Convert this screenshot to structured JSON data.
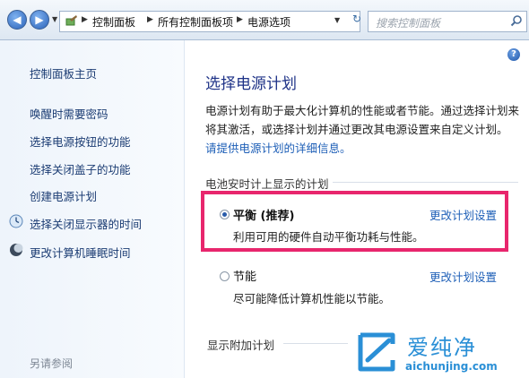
{
  "address_bar": {
    "breadcrumbs": [
      "控制面板",
      "所有控制面板项",
      "电源选项"
    ],
    "search_placeholder": "搜索控制面板"
  },
  "sidebar": {
    "items": [
      {
        "label": "控制面板主页"
      },
      {
        "label": "唤醒时需要密码"
      },
      {
        "label": "选择电源按钮的功能"
      },
      {
        "label": "选择关闭盖子的功能"
      },
      {
        "label": "创建电源计划"
      },
      {
        "label": "选择关闭显示器的时间",
        "icon": "display-clock-icon"
      },
      {
        "label": "更改计算机睡眠时间",
        "icon": "sleep-moon-icon"
      }
    ],
    "see_also": "另请参阅"
  },
  "main": {
    "title": "选择电源计划",
    "description": "电源计划有助于最大化计算机的性能或者节能。通过选择计划来将其激活，或选择计划并通过更改其电源设置来自定义计划。",
    "description_link": "请提供电源计划的详细信息。",
    "section_battery": "电池安时计上显示的计划",
    "plans": [
      {
        "name": "平衡 (推荐)",
        "desc": "利用可用的硬件自动平衡功耗与性能。",
        "link": "更改计划设置",
        "selected": true
      },
      {
        "name": "节能",
        "desc": "尽可能降低计算机性能以节能。",
        "link": "更改计划设置",
        "selected": false
      }
    ],
    "section_additional": "显示附加计划"
  },
  "watermark": {
    "text": "爱纯净",
    "url": "aichunjing.com"
  },
  "colors": {
    "highlight_border": "#e8266d",
    "link": "#1e5fb7",
    "title": "#1e3287"
  }
}
